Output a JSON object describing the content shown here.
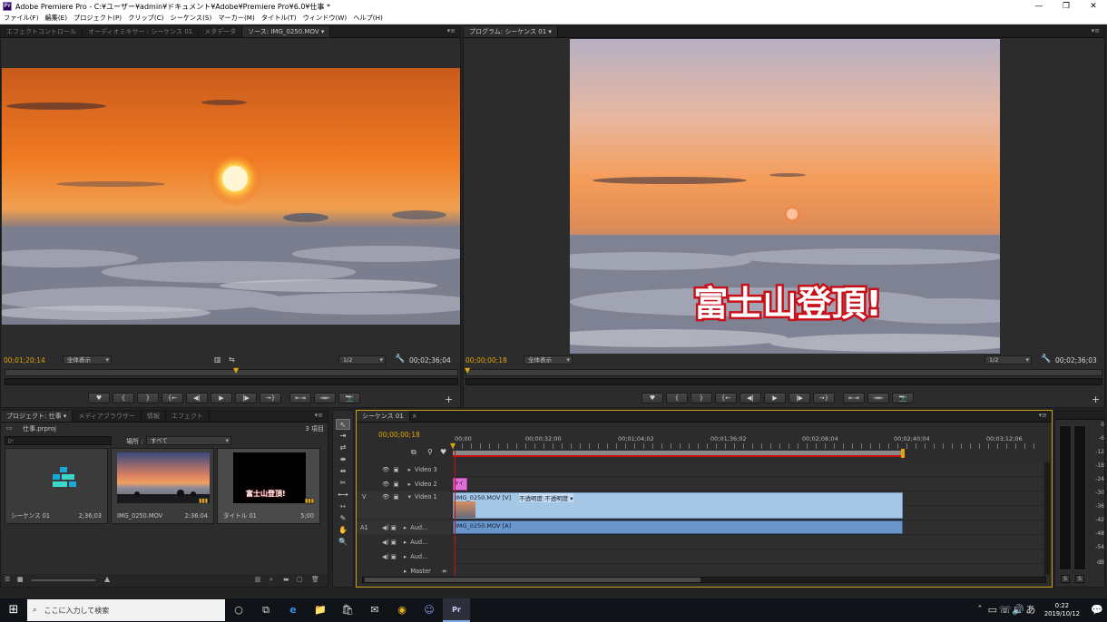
{
  "window": {
    "title": "Adobe Premiere Pro - C:¥ユーザー¥admin¥ドキュメント¥Adobe¥Premiere Pro¥6.0¥仕事 *",
    "app_icon": "Pr",
    "minimize": "—",
    "restore": "❐",
    "close": "✕"
  },
  "menu": [
    "ファイル(F)",
    "編集(E)",
    "プロジェクト(P)",
    "クリップ(C)",
    "シーケンス(S)",
    "マーカー(M)",
    "タイトル(T)",
    "ウィンドウ(W)",
    "ヘルプ(H)"
  ],
  "source_panel": {
    "tabs": [
      "エフェクトコントロール",
      "オーディオミキサー : シーケンス 01",
      "メタデータ",
      "ソース: IMG_0250.MOV ▾"
    ],
    "timecode": "00;01;20;14",
    "fit": "全体表示",
    "resolution": "1/2",
    "duration": "00;02;36;04",
    "playhead_fraction": 0.51
  },
  "program_panel": {
    "tabs": [
      "プログラム: シーケンス 01 ▾"
    ],
    "timecode": "00;00;00;18",
    "fit": "全体表示",
    "resolution": "1/2",
    "duration": "00;02;36;03",
    "title_overlay": "富士山登頂!",
    "playhead_fraction": 0.0
  },
  "transport_buttons": [
    "♥",
    "{",
    "}",
    "{←",
    "◀|",
    "▶",
    "|▶",
    "→}",
    "⇤⇥",
    "⇥⇤",
    "📷"
  ],
  "plus": "+",
  "project_panel": {
    "tabs": [
      "プロジェクト: 仕事 ▾",
      "メディアブラウザー",
      "情報",
      "エフェクト"
    ],
    "project_file": "仕事.prproj",
    "item_count": "3 項目",
    "search_placeholder": "ρ-",
    "location_label": "場所 :",
    "location_value": "すべて",
    "items": [
      {
        "name": "シーケンス 01",
        "duration": "2;36;03"
      },
      {
        "name": "IMG_0250.MOV",
        "duration": "2:36:04"
      },
      {
        "name": "タイトル 01",
        "duration": "5;00"
      }
    ],
    "thumb_title_text": "富士山登頂!"
  },
  "tools": [
    "↖",
    "⇥",
    "⇄",
    "⇼",
    "⇹",
    "✂",
    "⟷",
    "⇿",
    "✎",
    "✋",
    "🔍"
  ],
  "timeline": {
    "tab": "シーケンス 01",
    "timecode": "00;00;00;18",
    "ruler": [
      "00;00",
      "00;00;32;00",
      "00;01;04;02",
      "00;01;36;02",
      "00;02;08;04",
      "00;02;40;04",
      "00;03;12;06"
    ],
    "tracks": [
      {
        "id": "",
        "name": "Video 3",
        "type": "video"
      },
      {
        "id": "",
        "name": "Video 2",
        "type": "video"
      },
      {
        "id": "V",
        "name": "Video 1",
        "type": "video"
      },
      {
        "id": "A1",
        "name": "Aud...",
        "type": "audio"
      },
      {
        "id": "",
        "name": "Aud...",
        "type": "audio"
      },
      {
        "id": "",
        "name": "Aud...",
        "type": "audio"
      },
      {
        "id": "",
        "name": "Master",
        "type": "audio"
      }
    ],
    "video_clip_label": "IMG_0250.MOV [V]",
    "video_clip_effect": "不透明度:不透明度 ▾",
    "audio_clip_label": "IMG_0250.MOV [A]",
    "title_clip_label": "タイ"
  },
  "meter_scale": [
    "0",
    "-6",
    "-12",
    "-18",
    "-24",
    "-30",
    "-36",
    "-42",
    "-48",
    "-54",
    "dB"
  ],
  "meter_buttons": [
    "S",
    "S"
  ],
  "taskbar": {
    "start": "⊞",
    "search_placeholder": "ここに入力して検索",
    "icons": [
      "○",
      "⧉",
      "e",
      "📁",
      "🛍",
      "✉",
      "◉",
      "☺",
      "Pr"
    ],
    "tray": [
      "ˆ",
      "▭",
      "☏",
      "🔊",
      "あ"
    ],
    "time": "0:22",
    "date": "2019/10/12",
    "notifications": "💬"
  }
}
